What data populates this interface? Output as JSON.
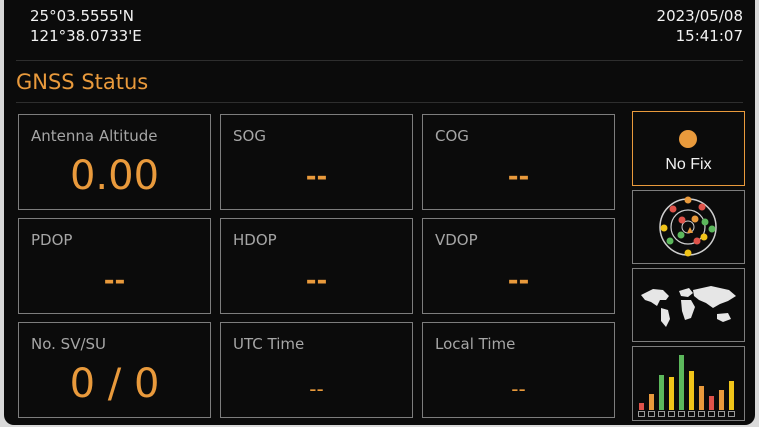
{
  "header": {
    "latitude": "25°03.5555'N",
    "longitude": "121°38.0733'E",
    "date": "2023/05/08",
    "time": "15:41:07"
  },
  "page": {
    "title": "GNSS Status"
  },
  "tiles": [
    {
      "label": "Antenna Altitude",
      "value": "0.00"
    },
    {
      "label": "SOG",
      "value": "--"
    },
    {
      "label": "COG",
      "value": "--"
    },
    {
      "label": "PDOP",
      "value": "--"
    },
    {
      "label": "HDOP",
      "value": "--"
    },
    {
      "label": "VDOP",
      "value": "--"
    },
    {
      "label": "No. SV/SU",
      "value": "0 / 0"
    },
    {
      "label": "UTC Time",
      "value": "--"
    },
    {
      "label": "Local Time",
      "value": "--"
    }
  ],
  "side_panel": {
    "fix_status": "No Fix",
    "buttons": [
      "sky-view-icon",
      "world-map-icon",
      "signal-strength-icon"
    ]
  },
  "colors": {
    "accent": "#e99a3c",
    "text": "#f2f2f2",
    "label": "#a6a6a6",
    "background": "#0b0b0b"
  }
}
